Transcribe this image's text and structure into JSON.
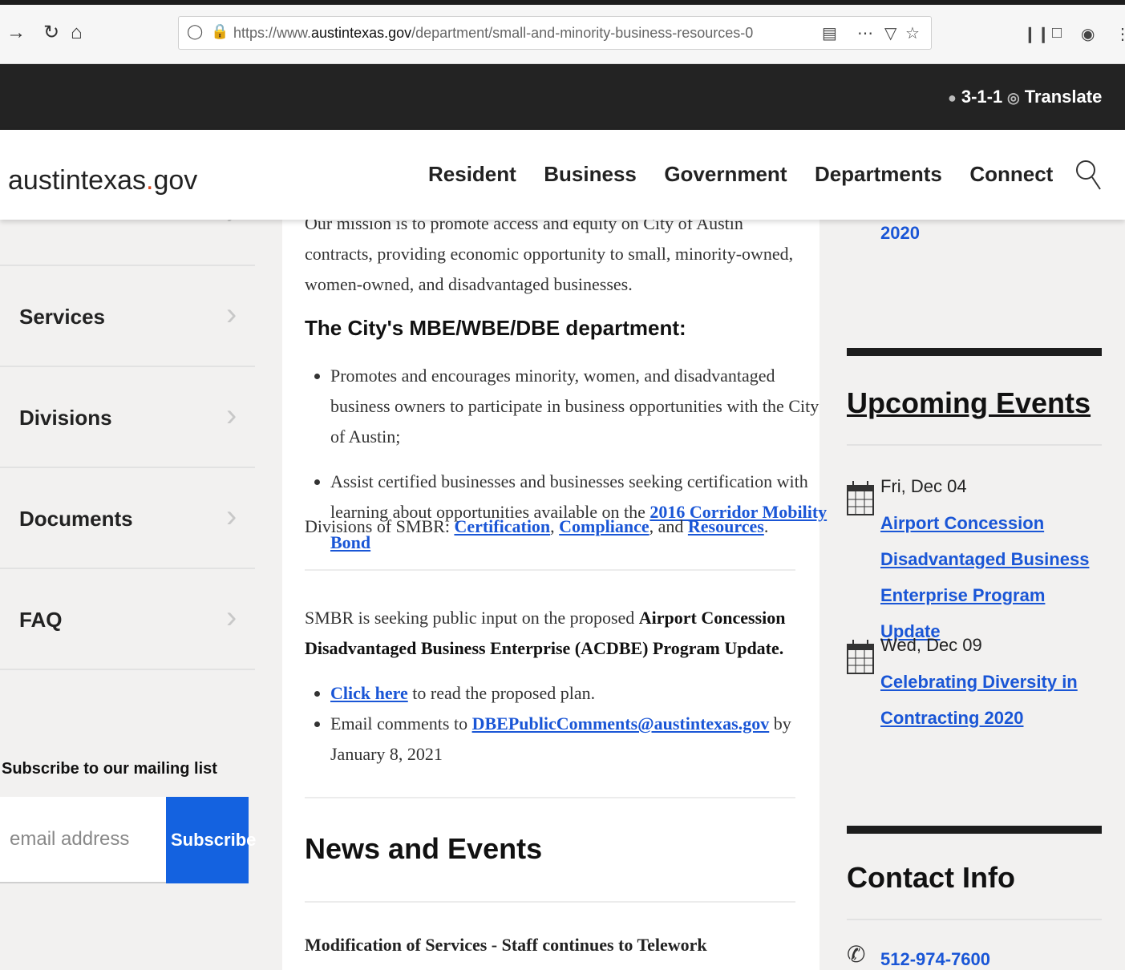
{
  "browser": {
    "url_prefix": "https://www.",
    "url_domain": "austintexas.gov",
    "url_path": "/department/small-and-minority-business-resources-0"
  },
  "utility": {
    "three_one_one": "3-1-1",
    "translate": "Translate"
  },
  "header": {
    "logo_main": "austintexas",
    "logo_dot": ".",
    "logo_tld": "gov",
    "nav": [
      "Resident",
      "Business",
      "Government",
      "Departments",
      "Connect"
    ]
  },
  "sidebar": {
    "items": [
      "Services",
      "Divisions",
      "Documents",
      "FAQ"
    ],
    "subscribe_title": "Subscribe to our mailing list",
    "email_placeholder": "email address",
    "subscribe_button": "Subscribe"
  },
  "main": {
    "mission": "Our mission is to promote access and equity on City of Austin contracts, providing economic opportunity to small, minority-owned, women-owned, and disadvantaged businesses.",
    "dept_heading": "The City's MBE/WBE/DBE department:",
    "bullet1": "Promotes and encourages minority, women, and disadvantaged business owners to participate in business opportunities with the City of Austin;",
    "bullet2_text": "Assist certified businesses and businesses seeking certification with learning about opportunities available on the ",
    "bullet2_link": "2016 Corridor Mobility Bond",
    "divisions_prefix": "Divisions of SMBR: ",
    "div_link1": "Certification",
    "div_sep1": ", ",
    "div_link2": "Compliance",
    "div_sep2": ", and ",
    "div_link3": "Resources",
    "div_end": ".",
    "seeking_text": "SMBR is seeking public input on the proposed ",
    "seeking_bold": "Airport Concession Disadvantaged Business Enterprise (ACDBE) Program Update.",
    "click_here": "Click here",
    "click_here_rest": " to read the proposed plan.",
    "email_prefix": "Email comments to ",
    "email_link": "DBEPublicComments@austintexas.gov",
    "email_suffix": " by January 8, 2021",
    "news_heading": "News and Events",
    "news_item": "Modification of Services - Staff continues to Telework"
  },
  "right": {
    "top_link": "2020",
    "events_heading": "Upcoming Events",
    "events": [
      {
        "date": "Fri, Dec 04",
        "title": "Airport Concession Disadvantaged Business Enterprise Program Update"
      },
      {
        "date": "Wed, Dec 09",
        "title": "Celebrating Diversity in Contracting 2020"
      }
    ],
    "contact_heading": "Contact Info",
    "phone": "512-974-7600"
  },
  "colors": {
    "link": "#1a56d6",
    "subscribe_button": "#1462e0",
    "utility_bar": "#232323",
    "logo_dot": "#e04a1f"
  }
}
